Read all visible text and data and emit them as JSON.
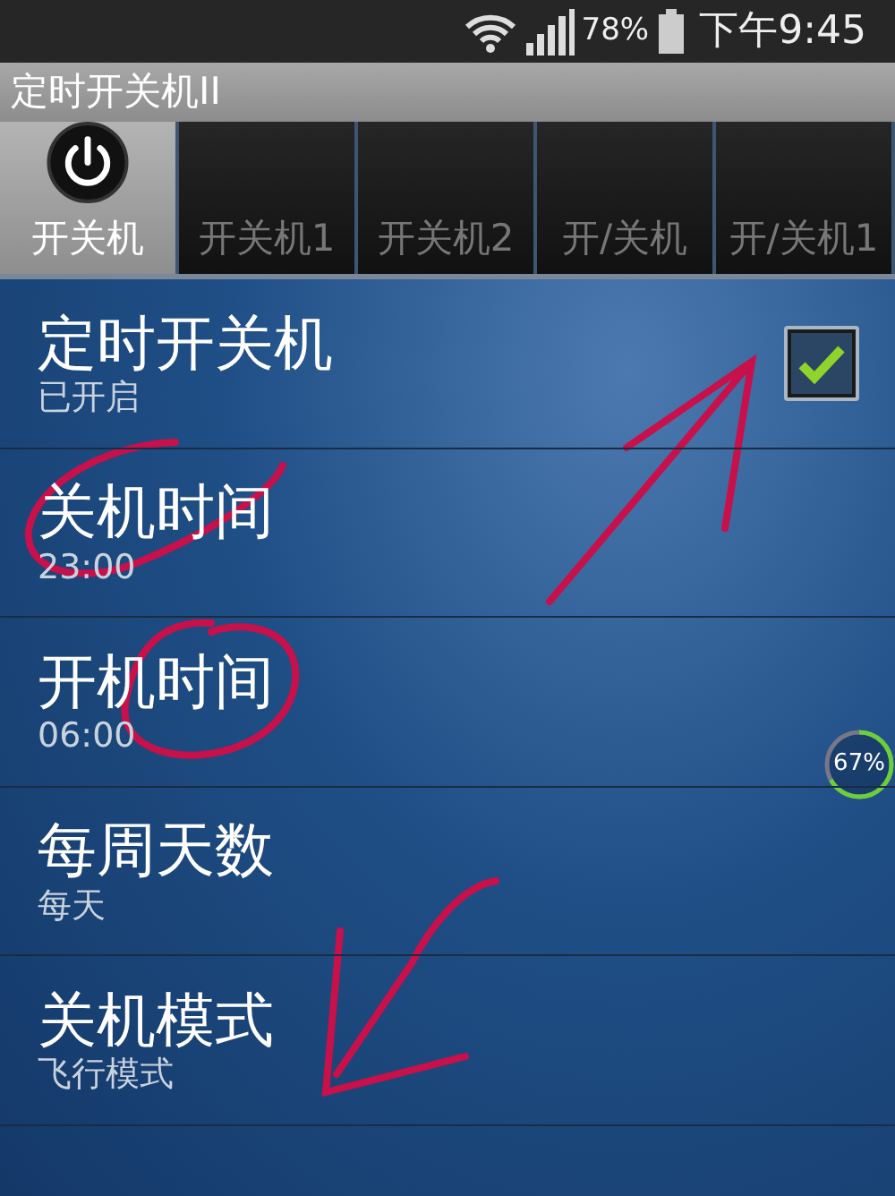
{
  "status_bar": {
    "battery_text": "78%",
    "time": "下午9:45"
  },
  "window": {
    "title": "定时开关机II"
  },
  "tabs": [
    {
      "label": "开关机",
      "selected": true
    },
    {
      "label": "开关机1",
      "selected": false
    },
    {
      "label": "开关机2",
      "selected": false
    },
    {
      "label": "开/关机",
      "selected": false
    },
    {
      "label": "开/关机1",
      "selected": false
    }
  ],
  "settings": [
    {
      "kind": "checkbox",
      "title": "定时开关机",
      "summary": "已开启",
      "checked": true
    },
    {
      "kind": "plain",
      "title": "关机时间",
      "summary": "23:00"
    },
    {
      "kind": "plain",
      "title": "开机时间",
      "summary": "06:00"
    },
    {
      "kind": "plain",
      "title": "每周天数",
      "summary": "每天"
    },
    {
      "kind": "plain",
      "title": "关机模式",
      "summary": "飞行模式"
    }
  ],
  "memory_widget": {
    "text": "67%",
    "level": 0.67
  }
}
